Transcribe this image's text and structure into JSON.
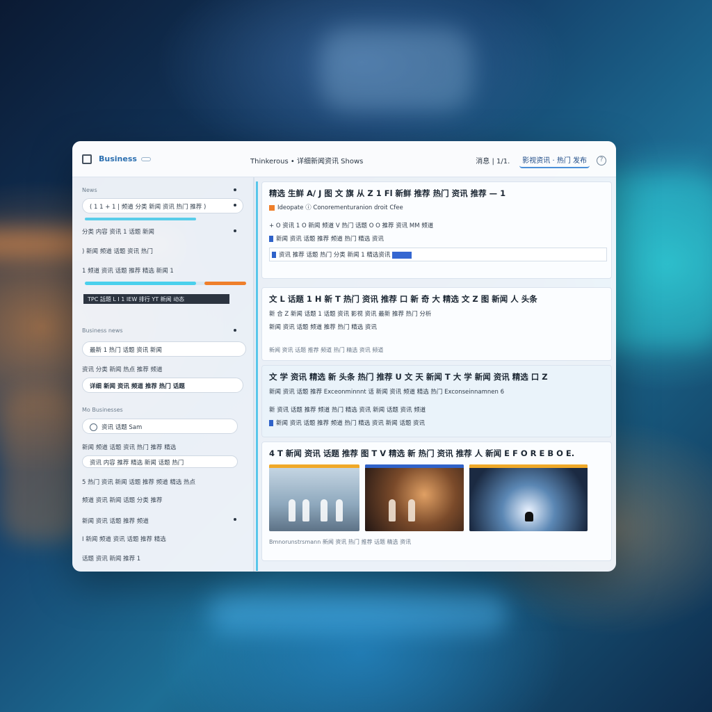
{
  "window": {
    "app_name": "Business",
    "breadcrumb": "Thinkerous • 详细新闻资讯 Shows",
    "toolbar": {
      "btn1": "消息 | 1/1.",
      "btn2": "影视资讯 · 热门 发布"
    }
  },
  "sidebar": {
    "section1_head": "News",
    "items": [
      "( 1 1 + 1 | 频道 分类 新闻 资讯 热门 推荐 )",
      "分类 内容 资讯 1 话题 新闻",
      ") 新闻 频道 话题 资讯 热门",
      "1 频道 资讯 话题 推荐 精选 新闻 1"
    ],
    "tag": "TPC 話題 L I 1 IEW 排行 YT 新闻 动态",
    "section2_head": "Business news",
    "pill1": "最新 1 热门 话题 资讯 新闻",
    "line1": "资讯 分类 新闻 热点 推荐 频道",
    "pill2": "详细 新闻 资讯 频道 推荐 热门 话题",
    "section3_head": "Mo Businesses",
    "radio_label": "资讯 话题 Sam",
    "bottom_items": [
      "新闻 频道 话题 资讯 热门 推荐 精选",
      "资讯 内容 推荐 精选 新闻 话题 热门",
      "5 热门 资讯 新闻 话题 推荐 频道 精选 热点",
      "频道 资讯 新闻 话题 分类 推荐",
      "新闻 资讯 话题 推荐 频道",
      "I 新闻 频道 资讯 话题 推荐 精选",
      "话题 资讯 新闻 推荐 1"
    ]
  },
  "main": {
    "card1": {
      "title": "精选 生鲜 A/ J 图 文 旗 从 Z 1 Fl 新鲜 推荐 热门 资讯 推荐 — 1",
      "subtitle": "Ideopate ⓘ Conorementuranion droit Cfee",
      "lines": [
        "+ O 资讯 1 O 新闻 频道 V 热门 话题 O O 推荐 资讯 MM 频道",
        "新闻 资讯 话题 推荐 频道 热门 精选 资讯",
        "资讯 推荐 话题 热门 分类 新闻 1 精选资讯"
      ]
    },
    "card2": {
      "title": "文 L 话题 1 H 新 T 热门 资讯 推荐 口 新 奇 大 精选 文 Z 图 新闻 人 头条",
      "lines": [
        "新 合 Z 新闻 话题 1 话题 资讯 影视 资讯 最新 推荐 热门 分析",
        "新闻 资讯 话题 频道 推荐 热门 精选 资讯"
      ],
      "meta": "新闻 资讯 话题 推荐 频道 热门 精选 资讯 频道"
    },
    "card3": {
      "title": "文 学 资讯 精选 新 头条 热门 推荐 U 文 天 新闻 T 大 学 新闻 资讯 精选 口 Z",
      "lines": [
        "新闻 资讯 话题 推荐 Exceonminnnt 话 新闻 资讯 频道 精选 热门 Exconseinnamnen 6",
        "新 资讯 话题 推荐 频道 热门 精选 资讯 新闻 话题 资讯 频道",
        "新闻 资讯 话题 推荐 频道 热门 精选 资讯 新闻 话题 资讯"
      ]
    },
    "card4": {
      "title": "4 T 新闻 资讯 话题 推荐 图 T V 精选 新 热门 资讯 推荐 人 新闻 E F O R E B O E.",
      "caption": "Bmnorunstrsmann 新闻 资讯 热门 推荐 话题 精选 资讯"
    }
  },
  "colors": {
    "accent_blue": "#3567d1",
    "accent_cyan": "#4ad0ec",
    "accent_orange": "#ef7f2b"
  }
}
